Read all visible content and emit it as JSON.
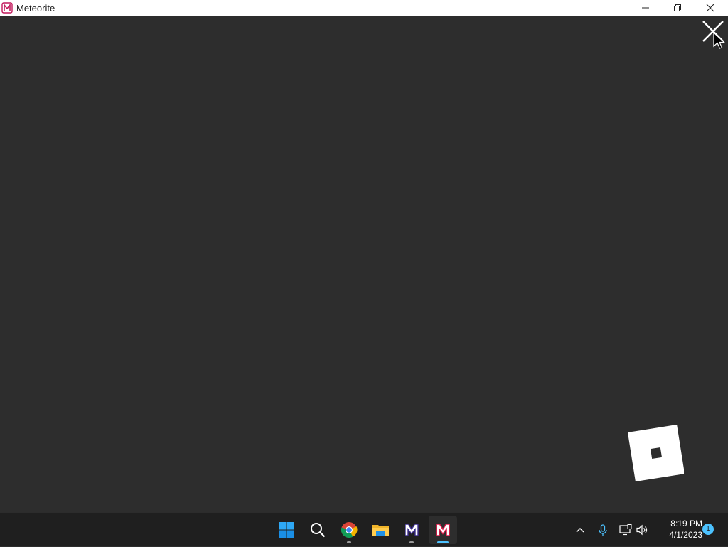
{
  "window": {
    "title": "Meteorite",
    "controls": [
      "minimize-icon",
      "restore-icon",
      "close-icon"
    ]
  },
  "content": {
    "background": "#2d2d2d",
    "close_overlay_icon": "close-icon",
    "logo_icon": "roblox-logo-icon"
  },
  "taskbar": {
    "apps": [
      {
        "name": "start",
        "icon": "windows-logo-icon"
      },
      {
        "name": "search",
        "icon": "search-icon"
      },
      {
        "name": "chrome",
        "icon": "chrome-icon",
        "running": true
      },
      {
        "name": "file-explorer",
        "icon": "folder-icon"
      },
      {
        "name": "meteorite-alt",
        "icon": "meteorite-m-icon",
        "running": true
      },
      {
        "name": "meteorite",
        "icon": "meteorite-m-icon",
        "active": true
      }
    ],
    "tray": {
      "icons": [
        "chevron-up-icon",
        "microphone-icon",
        "network-icon",
        "volume-icon"
      ],
      "time": "8:19 PM",
      "date": "4/1/2023",
      "notification_count": "1"
    },
    "accent": "#4cc2ff"
  }
}
